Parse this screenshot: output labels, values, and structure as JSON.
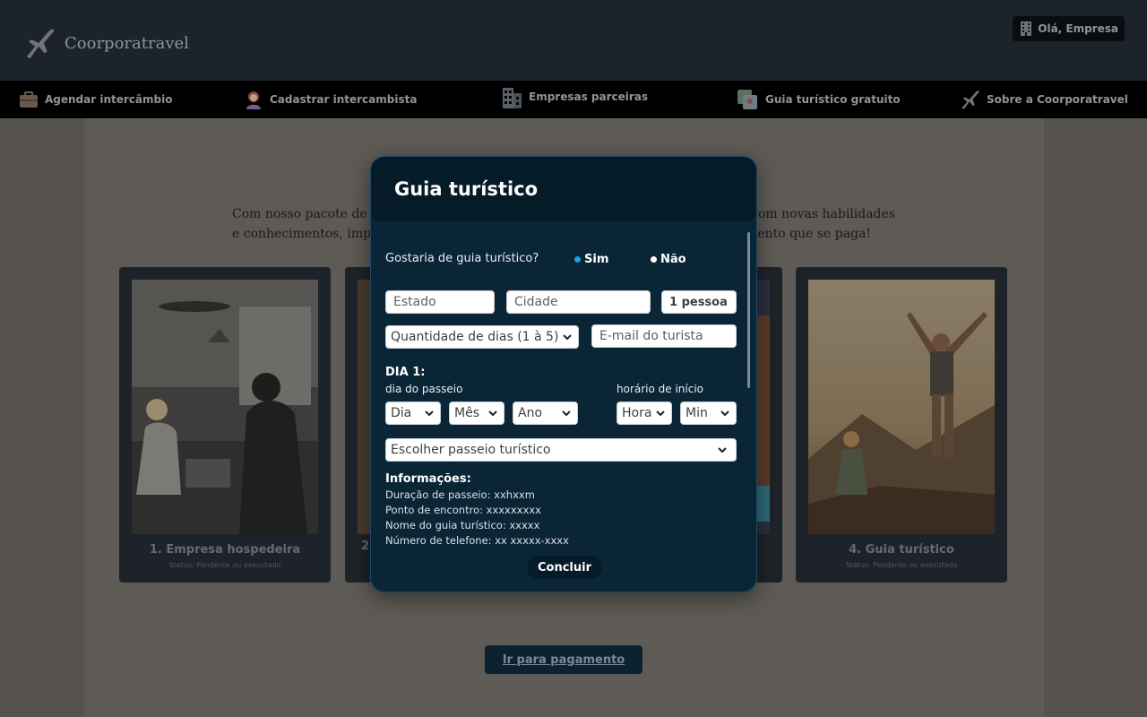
{
  "header": {
    "logo_text": "Coorporatravel",
    "logo_icon": "airplane-icon",
    "user_greeting": "Olá, Empresa",
    "user_icon": "building-icon"
  },
  "nav": {
    "items": [
      {
        "label": "Agendar intercâmbio",
        "icon": "briefcase-icon"
      },
      {
        "label": "Cadastrar intercambista",
        "icon": "person-icon"
      },
      {
        "label": "Empresas parceiras",
        "icon": "building-icon"
      },
      {
        "label": "Guia turístico gratuito",
        "icon": "map-icon"
      },
      {
        "label": "Sobre a Coorporatravel",
        "icon": "airplane-icon"
      }
    ]
  },
  "main": {
    "intro_line1": "Com nosso pacote de in",
    "intro_line1_end": "m com novas habilidades",
    "intro_line2": "e conhecimentos, impuls",
    "intro_line2_end": "imento que se paga!",
    "cards": [
      {
        "title": "1. Empresa hospedeira",
        "status": "Status: Pendente ou executado"
      },
      {
        "title": "2.",
        "status": ""
      },
      {
        "title": "",
        "status": ""
      },
      {
        "title": "4. Guia turístico",
        "status": "Status: Pendente ou executado"
      }
    ],
    "pay_button": "Ir para pagamento"
  },
  "modal": {
    "title": "Guia turístico",
    "question": "Gostaria de guia turístico?",
    "radio_yes": "Sim",
    "radio_no": "Não",
    "selected": "Sim",
    "colors": {
      "selected_dot": "#1aa3e8",
      "unselected_dot": "#ffffff",
      "modal_bg": "#0a2536"
    },
    "estado_placeholder": "Estado",
    "cidade_placeholder": "Cidade",
    "people_value": "1 pessoa",
    "days_select": "Quantidade de dias (1 à 5)",
    "email_placeholder": "E-mail do turista",
    "day_heading": "DIA 1:",
    "day_label": "dia do passeio",
    "time_label": "horário de início",
    "day_select": "Dia",
    "month_select": "Mês",
    "year_select": "Ano",
    "hour_select": "Hora",
    "minute_select": "Min",
    "tour_select": "Escolher passeio turístico",
    "info_heading": "Informações:",
    "info_lines": [
      "Duração de passeio: xxhxxm",
      "Ponto de encontro: xxxxxxxxx",
      "Nome do guia turístico: xxxxx",
      "Número de telefone: xx xxxxx-xxxx"
    ],
    "conclude_button": "Concluir"
  }
}
